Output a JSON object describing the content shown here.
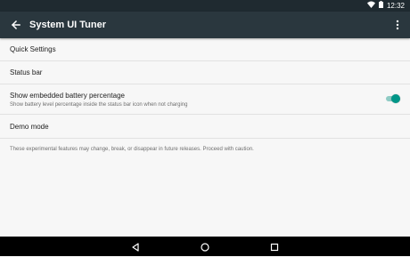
{
  "status_bar": {
    "time": "12:32",
    "icons": [
      "wifi-icon",
      "battery-icon"
    ]
  },
  "app_bar": {
    "title": "System UI Tuner",
    "icons": [
      "back-arrow-icon",
      "more-vert-icon"
    ]
  },
  "settings": {
    "quick_settings": "Quick Settings",
    "status_bar": "Status bar",
    "battery_percentage": {
      "title": "Show embedded battery percentage",
      "summary": "Show battery level percentage inside the status bar icon when not charging",
      "enabled": true
    },
    "demo_mode": "Demo mode"
  },
  "footer_note": "These experimental features may change, break, or disappear in future releases. Proceed with caution.",
  "nav_bar": {
    "icons": [
      "back-triangle-icon",
      "home-circle-icon",
      "recents-square-icon"
    ]
  },
  "colors": {
    "accent": "#009688",
    "app_bar": "#2a373e",
    "status_bar": "#1f2a30"
  }
}
